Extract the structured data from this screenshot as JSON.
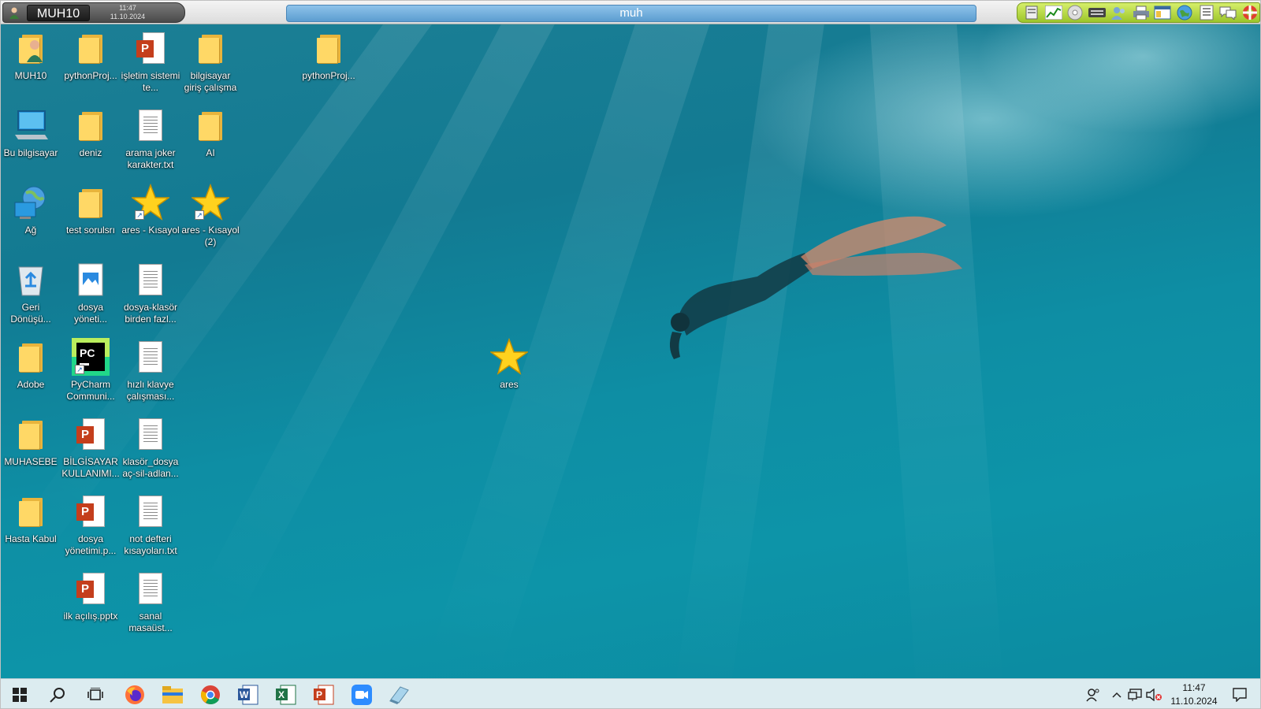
{
  "session": {
    "host": "MUH10",
    "time": "11:47",
    "date": "11.10.2024",
    "title": "muh",
    "tools": [
      "save-icon",
      "chart-icon",
      "disc-icon",
      "keyboard-icon",
      "users-icon",
      "printer-icon",
      "window-icon",
      "globe-icon",
      "list-icon",
      "chat-icon",
      "lifebuoy-icon"
    ]
  },
  "desktop": {
    "icons": [
      {
        "name": "muh10",
        "label": "MUH10",
        "type": "user-folder"
      },
      {
        "name": "pythonproj-1",
        "label": "pythonProj...",
        "type": "folder"
      },
      {
        "name": "isletim-sistemi",
        "label": "işletim sistemi te...",
        "type": "ppt"
      },
      {
        "name": "bilgisayar-giris",
        "label": "bilgisayar giriş çalışma",
        "type": "folder"
      },
      {
        "name": "pythonproj-2",
        "label": "pythonProj...",
        "type": "folder"
      },
      {
        "name": "bu-bilgisayar",
        "label": "Bu bilgisayar",
        "type": "computer"
      },
      {
        "name": "deniz",
        "label": "deniz",
        "type": "folder"
      },
      {
        "name": "arama-joker",
        "label": "arama joker karakter.txt",
        "type": "doc"
      },
      {
        "name": "ai",
        "label": "AI",
        "type": "folder"
      },
      {
        "name": "ag",
        "label": "Ağ",
        "type": "network"
      },
      {
        "name": "test-sorulsri",
        "label": "test sorulsrı",
        "type": "folder"
      },
      {
        "name": "ares-kisayol",
        "label": "ares - Kısayol",
        "type": "star-shortcut"
      },
      {
        "name": "ares-kisayol-2",
        "label": "ares - Kısayol (2)",
        "type": "star-shortcut"
      },
      {
        "name": "geri-donusum",
        "label": "Geri Dönüşü...",
        "type": "recycle"
      },
      {
        "name": "dosya-yoneti",
        "label": "dosya yöneti...",
        "type": "image"
      },
      {
        "name": "dosya-klasor",
        "label": "dosya-klasör birden fazl...",
        "type": "doc"
      },
      {
        "name": "adobe",
        "label": "Adobe",
        "type": "folder"
      },
      {
        "name": "pycharm",
        "label": "PyCharm Communi...",
        "type": "pycharm"
      },
      {
        "name": "hizli-klavye",
        "label": "hızlı klavye çalışması...",
        "type": "doc"
      },
      {
        "name": "ares",
        "label": "ares",
        "type": "star"
      },
      {
        "name": "muhasebe",
        "label": "MUHASEBE",
        "type": "folder"
      },
      {
        "name": "bilgisayar-kullanimi",
        "label": "BİLGİSAYAR KULLANIMI...",
        "type": "ppt"
      },
      {
        "name": "klasor-dosya",
        "label": "klasör_dosya aç-sil-adlan...",
        "type": "doc"
      },
      {
        "name": "hasta-kabul",
        "label": "Hasta Kabul",
        "type": "folder"
      },
      {
        "name": "dosya-yonetimi-p",
        "label": "dosya yönetimi.p...",
        "type": "ppt"
      },
      {
        "name": "not-defteri",
        "label": "not defteri kısayoları.txt",
        "type": "doc"
      },
      {
        "name": "ilk-acilis",
        "label": "ilk açılış.pptx",
        "type": "ppt"
      },
      {
        "name": "sanal-masaust",
        "label": "sanal masaüst...",
        "type": "doc"
      }
    ]
  },
  "taskbar": {
    "apps": [
      "start-icon",
      "search-icon",
      "task-view-icon",
      "firefox-icon",
      "file-explorer-icon",
      "chrome-icon",
      "word-icon",
      "excel-icon",
      "powerpoint-icon",
      "zoom-icon",
      "eraser-icon"
    ],
    "time": "11:47",
    "date": "11.10.2024"
  }
}
